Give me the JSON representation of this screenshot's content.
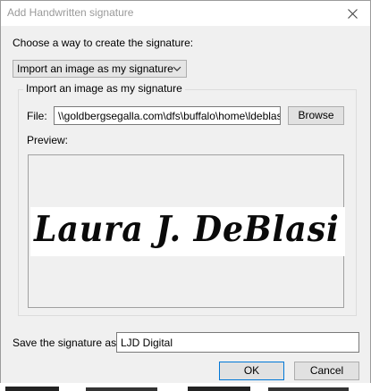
{
  "dialog": {
    "title": "Add Handwritten signature",
    "choose_label": "Choose a way to create the signature:",
    "method_select": {
      "selected": "Import an image as my signature"
    },
    "group_title": "Import an image as my signature",
    "file_label": "File:",
    "file_path": "\\\\goldbergsegalla.com\\dfs\\buffalo\\home\\ldeblasi\\D",
    "browse_label": "Browse",
    "preview_label": "Preview:",
    "signature_preview_text": "Laura J. DeBlasi",
    "save_as_label": "Save the signature as:",
    "save_as_value": "LJD Digital",
    "ok_label": "OK",
    "cancel_label": "Cancel"
  },
  "colors": {
    "dialog_bg": "#f0f0f0",
    "title_text": "#9a9a9a",
    "button_bg": "#e1e1e1",
    "border": "#adadad"
  },
  "icons": {
    "close": "close-icon",
    "dropdown": "chevron-down-icon"
  }
}
